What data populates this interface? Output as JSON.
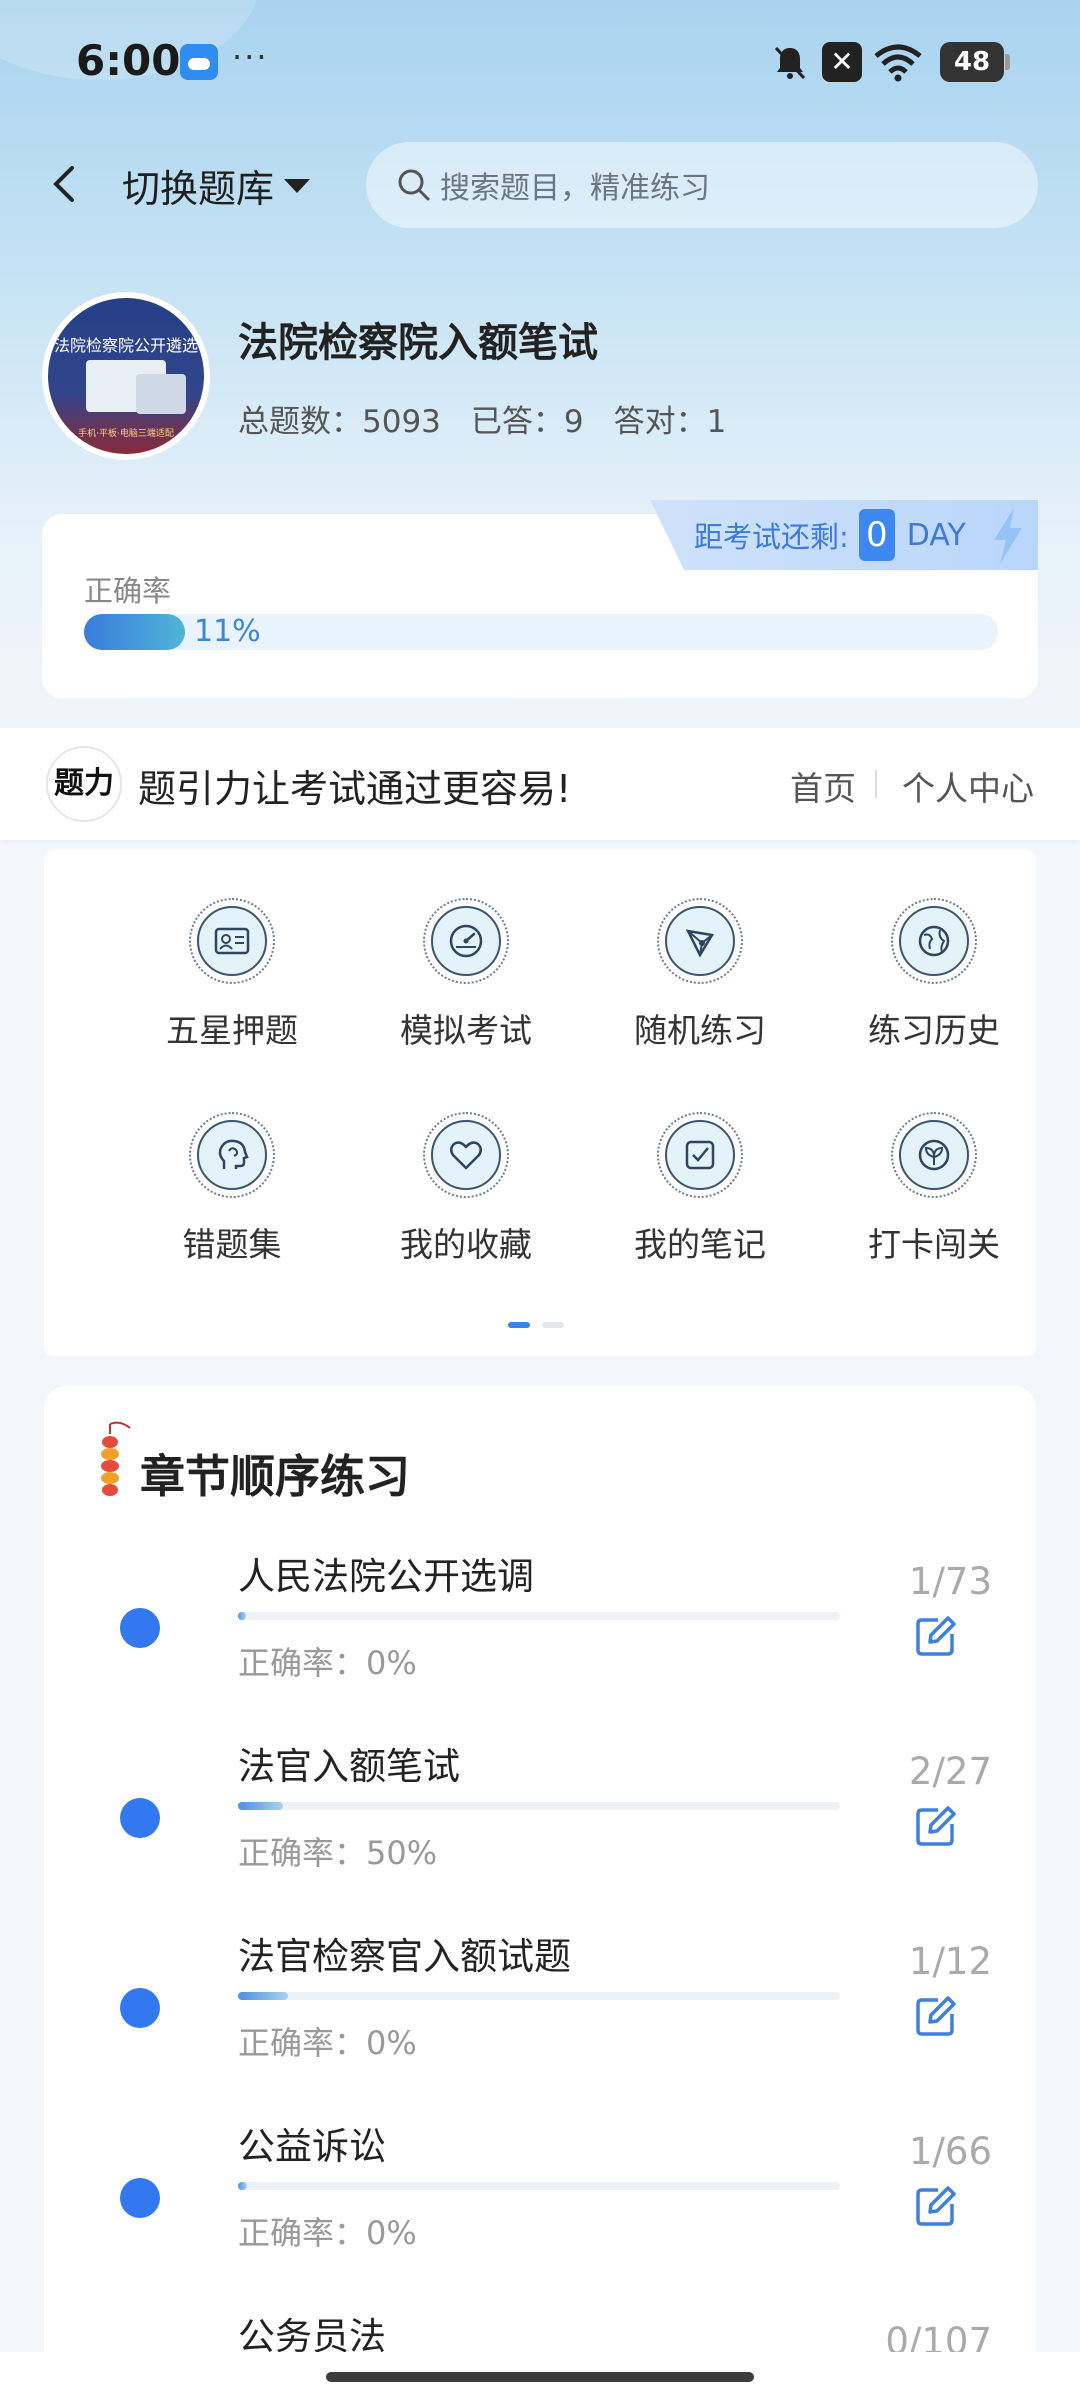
{
  "status_bar": {
    "time": "6:00",
    "more": "···",
    "battery": "48"
  },
  "header": {
    "switch_label": "切换题库",
    "search_placeholder": "搜索题目，精准练习"
  },
  "bank": {
    "cover_text": "法院检察院公开遴选",
    "cover_sub": "手机·平板·电脑三端适配",
    "title": "法院检察院入额笔试",
    "total_label": "总题数：",
    "total": "5093",
    "answered_label": "已答：",
    "answered": "9",
    "correct_label": "答对：",
    "correct": "1"
  },
  "countdown": {
    "label": "距考试还剩:",
    "days": "0",
    "unit": "DAY"
  },
  "accuracy": {
    "label": "正确率",
    "value": "11%",
    "fraction": 0.11
  },
  "banner": {
    "logo": "题力",
    "slogan": "题引力让考试通过更容易!",
    "home": "首页",
    "center": "个人中心"
  },
  "features": [
    {
      "label": "五星押题",
      "icon": "id-card-icon"
    },
    {
      "label": "模拟考试",
      "icon": "gauge-icon"
    },
    {
      "label": "随机练习",
      "icon": "network-icon"
    },
    {
      "label": "练习历史",
      "icon": "globe-icon"
    },
    {
      "label": "错题集",
      "icon": "head-icon"
    },
    {
      "label": "我的收藏",
      "icon": "heart-icon"
    },
    {
      "label": "我的笔记",
      "icon": "note-check-icon"
    },
    {
      "label": "打卡闯关",
      "icon": "sprout-icon"
    }
  ],
  "chapter_section": {
    "title": "章节顺序练习"
  },
  "chapters": [
    {
      "name": "人民法院公开选调",
      "accuracy": "正确率：0%",
      "count": "1/73",
      "progress": 0.014
    },
    {
      "name": "法官入额笔试",
      "accuracy": "正确率：50%",
      "count": "2/27",
      "progress": 0.074
    },
    {
      "name": "法官检察官入额试题",
      "accuracy": "正确率：0%",
      "count": "1/12",
      "progress": 0.083
    },
    {
      "name": "公益诉讼",
      "accuracy": "正确率：0%",
      "count": "1/66",
      "progress": 0.015
    },
    {
      "name": "公务员法",
      "accuracy": "",
      "count": "0/107",
      "progress": 0
    }
  ],
  "colors": {
    "accent": "#3478f0",
    "progress_gradient_start": "#3a7bdc",
    "progress_gradient_end": "#4fb5d6"
  }
}
